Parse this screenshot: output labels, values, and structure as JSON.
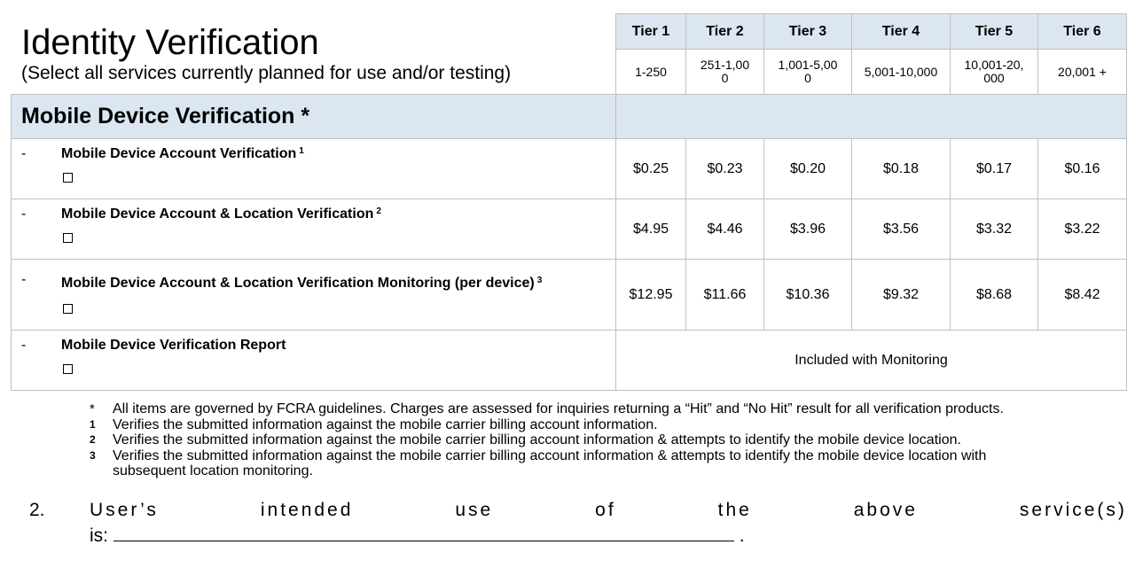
{
  "header": {
    "title": "Identity Verification",
    "subtitle": "(Select all services currently planned for use and/or testing)"
  },
  "tiers": [
    {
      "label": "Tier 1",
      "range": "1-250",
      "range_lines": [
        "1-250"
      ]
    },
    {
      "label": "Tier 2",
      "range": "251-1,000",
      "range_lines": [
        "251-1,00",
        "0"
      ]
    },
    {
      "label": "Tier 3",
      "range": "1,001-5,000",
      "range_lines": [
        "1,001-5,00",
        "0"
      ]
    },
    {
      "label": "Tier 4",
      "range": "5,001-10,000",
      "range_lines": [
        "5,001-10,000"
      ]
    },
    {
      "label": "Tier 5",
      "range": "10,001-20,000",
      "range_lines": [
        "10,001-20,",
        "000"
      ]
    },
    {
      "label": "Tier 6",
      "range": "20,001 +",
      "range_lines": [
        "20,001 +"
      ]
    }
  ],
  "section": {
    "title": "Mobile Device Verification *"
  },
  "services": [
    {
      "bullet": "-",
      "label": "Mobile Device Account Verification",
      "footnote": "1",
      "checked": false,
      "prices": [
        "$0.25",
        "$0.23",
        "$0.20",
        "$0.18",
        "$0.17",
        "$0.16"
      ]
    },
    {
      "bullet": "-",
      "label": "Mobile Device Account & Location Verification",
      "footnote": "2",
      "checked": false,
      "prices": [
        "$4.95",
        "$4.46",
        "$3.96",
        "$3.56",
        "$3.32",
        "$3.22"
      ]
    },
    {
      "bullet": "-",
      "label": "Mobile Device Account & Location Verification Monitoring (per device)",
      "footnote": "3",
      "checked": false,
      "prices": [
        "$12.95",
        "$11.66",
        "$10.36",
        "$9.32",
        "$8.68",
        "$8.42"
      ]
    },
    {
      "bullet": "-",
      "label": "Mobile Device Verification Report",
      "footnote": "",
      "checked": false,
      "merged_price": "Included with Monitoring"
    }
  ],
  "footnotes": [
    {
      "mark": "*",
      "text": "All items are governed by FCRA guidelines. Charges are assessed for inquiries returning a “Hit” and “No Hit” result for all verification products."
    },
    {
      "mark": "1",
      "text": "Verifies the submitted information against the mobile carrier billing account information."
    },
    {
      "mark": "2",
      "text": "Verifies the submitted information against the mobile carrier billing account information & attempts to identify the mobile device location."
    },
    {
      "mark": "3",
      "text": "Verifies the submitted information against the mobile carrier billing account information & attempts to identify the mobile device location with",
      "continuation": "subsequent location monitoring."
    }
  ],
  "question": {
    "number": "2.",
    "words": [
      "User’s",
      "intended",
      "use",
      "of",
      "the",
      "above",
      "service(s)"
    ],
    "line2_prefix": "is:",
    "line2_suffix": ".",
    "answer_value": ""
  }
}
